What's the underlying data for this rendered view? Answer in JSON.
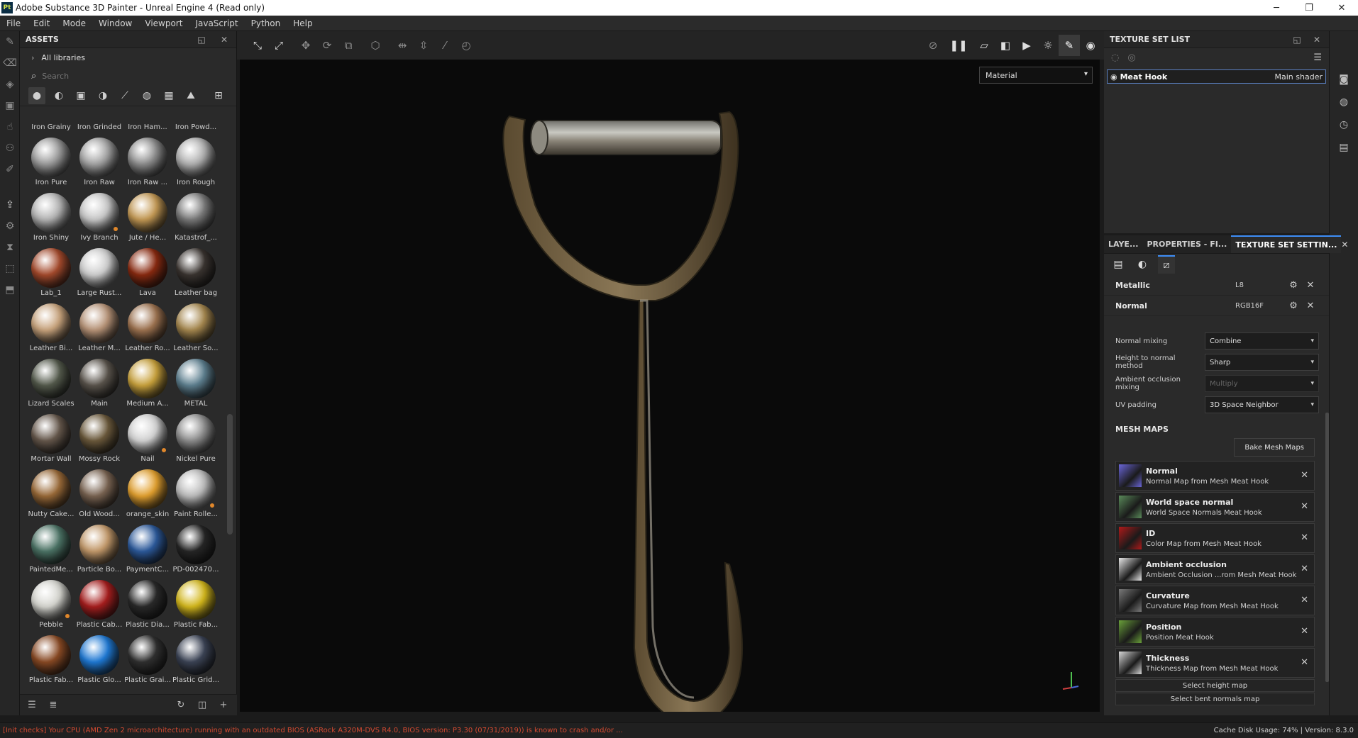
{
  "window": {
    "app_icon": "Pt",
    "title": "Adobe Substance 3D Painter - Unreal Engine 4 (Read only)",
    "controls": [
      "minimize-icon",
      "restore-icon",
      "close-icon"
    ]
  },
  "menu": [
    "File",
    "Edit",
    "Mode",
    "Window",
    "Viewport",
    "JavaScript",
    "Python",
    "Help"
  ],
  "left_tools": [
    "paint-brush-icon",
    "eraser-icon",
    "projection-icon",
    "polygon-fill-icon",
    "smudge-icon",
    "clone-icon",
    "color-picker-icon",
    "export-icon",
    "bake-icon",
    "fill-icon",
    "geometry-mask-icon",
    "uv-tool-icon"
  ],
  "assets": {
    "title": "ASSETS",
    "library": "All libraries",
    "search_placeholder": "Search",
    "top_row_names": [
      "Iron Grainy",
      "Iron Grinded",
      "Iron Ham...",
      "Iron Powd..."
    ],
    "items": [
      [
        {
          "name": "Iron Pure",
          "color": "#9a9a9a"
        },
        {
          "name": "Iron Raw",
          "color": "#a3a3a3"
        },
        {
          "name": "Iron Raw ...",
          "color": "#8c8c8c"
        },
        {
          "name": "Iron Rough",
          "color": "#b0b0b0"
        }
      ],
      [
        {
          "name": "Iron Shiny",
          "color": "#b5b5b5"
        },
        {
          "name": "Ivy Branch",
          "color": "#c9c9c9",
          "dot": true
        },
        {
          "name": "Jute / He...",
          "color": "#c59a55"
        },
        {
          "name": "Katastrof_...",
          "color": "#7a7a7a"
        }
      ],
      [
        {
          "name": "Lab_1",
          "color": "#a54a2c"
        },
        {
          "name": "Large Rust...",
          "color": "#cfcfcf"
        },
        {
          "name": "Lava",
          "color": "#8a2a10"
        },
        {
          "name": "Leather bag",
          "color": "#3a3430"
        }
      ],
      [
        {
          "name": "Leather Bi...",
          "color": "#c9a47d"
        },
        {
          "name": "Leather M...",
          "color": "#b89478"
        },
        {
          "name": "Leather Ro...",
          "color": "#9e7350"
        },
        {
          "name": "Leather So...",
          "color": "#a6884f"
        }
      ],
      [
        {
          "name": "Lizard Scales",
          "color": "#545a4c"
        },
        {
          "name": "Main",
          "color": "#5a544c"
        },
        {
          "name": "Medium A...",
          "color": "#c9a23c"
        },
        {
          "name": "METAL",
          "color": "#5e8090"
        }
      ],
      [
        {
          "name": "Mortar Wall",
          "color": "#66584c"
        },
        {
          "name": "Mossy Rock",
          "color": "#6c5a3c"
        },
        {
          "name": "Nail",
          "color": "#d4d4d4",
          "dot": true
        },
        {
          "name": "Nickel Pure",
          "color": "#8e8e8e"
        }
      ],
      [
        {
          "name": "Nutty Cake...",
          "color": "#9a6a38"
        },
        {
          "name": "Old Wood...",
          "color": "#7a6452"
        },
        {
          "name": "orange_skin",
          "color": "#e3a12f"
        },
        {
          "name": "Paint Rolle...",
          "color": "#bdbdbd",
          "dot": true
        }
      ],
      [
        {
          "name": "PaintedMe...",
          "color": "#4c7466"
        },
        {
          "name": "Particle Bo...",
          "color": "#c49a6b"
        },
        {
          "name": "PaymentC...",
          "color": "#2c5a9c"
        },
        {
          "name": "PD-002470...",
          "color": "#262626"
        }
      ],
      [
        {
          "name": "Pebble",
          "color": "#d6d6d0",
          "dot": true
        },
        {
          "name": "Plastic Cab...",
          "color": "#a81e1e"
        },
        {
          "name": "Plastic Dia...",
          "color": "#2a2a2a"
        },
        {
          "name": "Plastic Fab...",
          "color": "#d4b81c"
        }
      ],
      [
        {
          "name": "Plastic Fab...",
          "color": "#8a4a24"
        },
        {
          "name": "Plastic Glo...",
          "color": "#1f7ad6"
        },
        {
          "name": "Plastic Grai...",
          "color": "#303030"
        },
        {
          "name": "Plastic Grid...",
          "color": "#3c4456"
        }
      ]
    ],
    "filters": [
      "material-icon",
      "smart-material-icon",
      "smart-mask-icon",
      "filter-icon",
      "brush-icon",
      "particle-icon",
      "texture-icon",
      "environment-icon",
      "grid-view-icon"
    ],
    "footer": [
      "list-view-icon",
      "sub-list-icon",
      "refresh-icon",
      "new-window-icon",
      "add-icon"
    ]
  },
  "viewport": {
    "toolbar_left": [
      "transform-icon",
      "uv-transform-icon",
      "move-icon",
      "rotate-icon",
      "scale-icon",
      "cube-icon",
      "mirror-x-icon",
      "mirror-y-icon",
      "symmetry-icon",
      "history-icon"
    ],
    "toolbar_right": [
      "hide-icon",
      "pause-icon",
      "2d-view-icon",
      "3d-view-icon",
      "camera-icon",
      "light-icon",
      "paint-mode-icon",
      "screenshot-icon"
    ],
    "mode": "Material"
  },
  "texture_set_list": {
    "title": "TEXTURE SET LIST",
    "item_name": "Meat Hook",
    "item_shader": "Main shader"
  },
  "right_sidebar": [
    "texture-set-icon",
    "display-settings-icon",
    "history-icon",
    "log-icon"
  ],
  "settings_panel": {
    "tabs": [
      "LAYE...",
      "PROPERTIES - FI...",
      "TEXTURE SET SETTIN..."
    ],
    "channels": [
      {
        "name": "Metallic",
        "format": "L8"
      },
      {
        "name": "Normal",
        "format": "RGB16F"
      }
    ],
    "props": [
      {
        "label": "Normal mixing",
        "value": "Combine",
        "disabled": false
      },
      {
        "label": "Height to normal method",
        "value": "Sharp",
        "disabled": false
      },
      {
        "label": "Ambient occlusion mixing",
        "value": "Multiply",
        "disabled": true
      },
      {
        "label": "UV padding",
        "value": "3D Space Neighbor",
        "disabled": false
      }
    ],
    "mesh_maps_title": "MESH MAPS",
    "bake_button": "Bake Mesh Maps",
    "mesh_maps": [
      {
        "title": "Normal",
        "subtitle": "Normal Map from Mesh Meat Hook",
        "color": "#6a66d8"
      },
      {
        "title": "World space normal",
        "subtitle": "World Space Normals Meat Hook",
        "color": "#5a8a5a"
      },
      {
        "title": "ID",
        "subtitle": "Color Map from Mesh Meat Hook",
        "color": "#b01a1a"
      },
      {
        "title": "Ambient occlusion",
        "subtitle": "Ambient Occlusion ...rom Mesh Meat Hook",
        "color": "#e8e8e8"
      },
      {
        "title": "Curvature",
        "subtitle": "Curvature Map from Mesh Meat Hook",
        "color": "#7a7a7a"
      },
      {
        "title": "Position",
        "subtitle": "Position Meat Hook",
        "color": "#6aa03a"
      },
      {
        "title": "Thickness",
        "subtitle": "Thickness Map from Mesh Meat Hook",
        "color": "#d8d8d8"
      }
    ],
    "select_height": "Select height map",
    "select_bent": "Select bent normals map"
  },
  "status": {
    "message": "[Init checks] Your CPU (AMD Zen 2 microarchitecture) running with an outdated BIOS (ASRock A320M-DVS R4.0, BIOS version: P3.30 (07/31/2019)) is known to crash and/or ...",
    "cache": "Cache Disk Usage:   74% | Version: 8.3.0"
  },
  "colors": {
    "accent": "#3e8ef7",
    "error": "#d34a31"
  }
}
